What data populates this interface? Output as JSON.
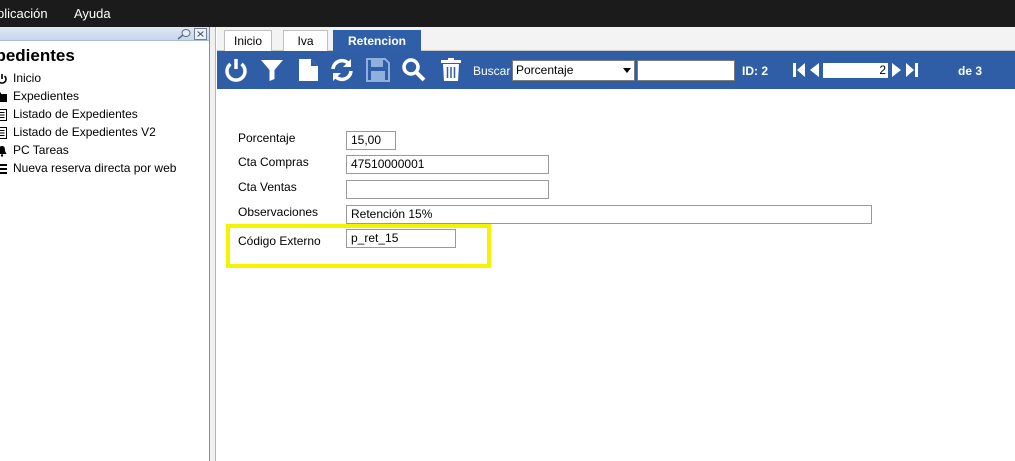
{
  "menu": {
    "items": [
      "plicación",
      "Ayuda"
    ]
  },
  "left_panel": {
    "title": "xpedientes",
    "items": [
      {
        "label": "Inicio",
        "icon": "power-icon"
      },
      {
        "label": "Expedientes",
        "icon": "folder-icon"
      },
      {
        "label": "Listado de Expedientes",
        "icon": "list-icon"
      },
      {
        "label": "Listado de Expedientes V2",
        "icon": "list-icon"
      },
      {
        "label": "PC Tareas",
        "icon": "bell-icon"
      },
      {
        "label": "Nueva reserva directa por web",
        "icon": "menu-icon"
      }
    ]
  },
  "tabs": [
    {
      "label": "Inicio",
      "active": false
    },
    {
      "label": "Iva",
      "active": false
    },
    {
      "label": "Retencion",
      "active": true
    }
  ],
  "toolbar": {
    "buscar_label": "Buscar",
    "search_field": {
      "value": "Porcentaje"
    },
    "search_text": "",
    "id_label": "ID: 2",
    "page_value": "2",
    "page_total_label": "de 3",
    "icons": [
      "power-icon",
      "filter-icon",
      "new-document-icon",
      "refresh-icon",
      "save-icon",
      "search-icon",
      "delete-icon"
    ]
  },
  "form": {
    "fields": [
      {
        "label": "Porcentaje",
        "value": "15,00"
      },
      {
        "label": "Cta Compras",
        "value": "47510000001"
      },
      {
        "label": "Cta Ventas",
        "value": ""
      },
      {
        "label": "Observaciones",
        "value": "Retención 15%"
      },
      {
        "label": "Código Externo",
        "value": "p_ret_15"
      }
    ]
  },
  "colors": {
    "toolbar": "#2f5ea6",
    "menubar": "#1b1b1b",
    "highlight": "#f4f400"
  }
}
